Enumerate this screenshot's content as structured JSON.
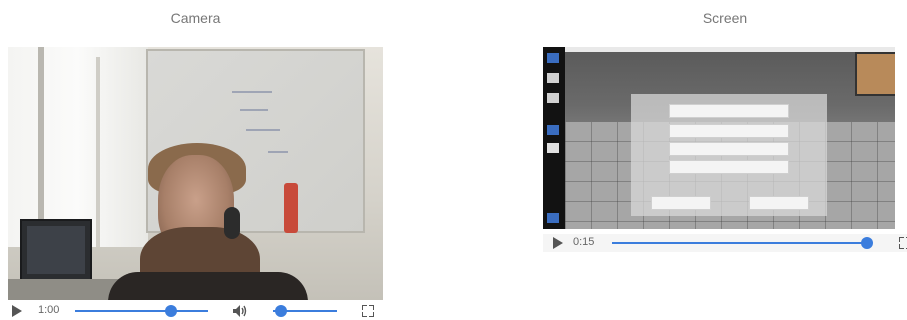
{
  "camera": {
    "title": "Camera",
    "controls": {
      "time": "1:00",
      "progress": 0.72,
      "volume": 0.12
    }
  },
  "screen": {
    "title": "Screen",
    "controls": {
      "time": "0:15",
      "progress": 0.98
    },
    "menu": {
      "buttons": [
        "",
        "",
        "",
        ""
      ],
      "bottom_left": "",
      "bottom_right": ""
    }
  },
  "colors": {
    "accent": "#3b7ddd",
    "icon": "#555555"
  },
  "icons": {
    "play": "play-icon",
    "volume": "volume-icon",
    "fullscreen": "fullscreen-icon"
  }
}
